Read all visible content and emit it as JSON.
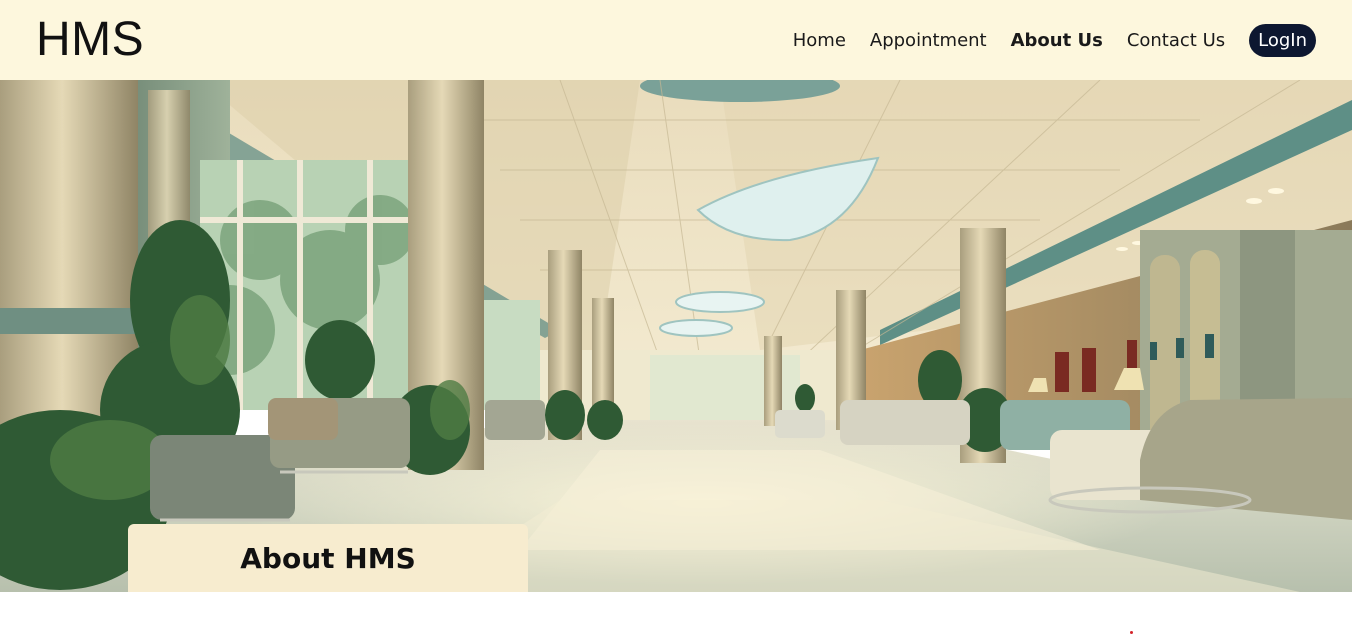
{
  "brand": {
    "name": "HMS"
  },
  "nav": {
    "home": "Home",
    "appointment": "Appointment",
    "about": "About Us",
    "contact": "Contact Us",
    "login": "LogIn",
    "active_item": "About Us"
  },
  "hero": {
    "image": "hospital-lobby-image",
    "heading": "About HMS"
  },
  "colors": {
    "navbar_bg": "#fdf7dd",
    "login_bg": "#0d1730",
    "card_bg": "#f7eccf"
  }
}
